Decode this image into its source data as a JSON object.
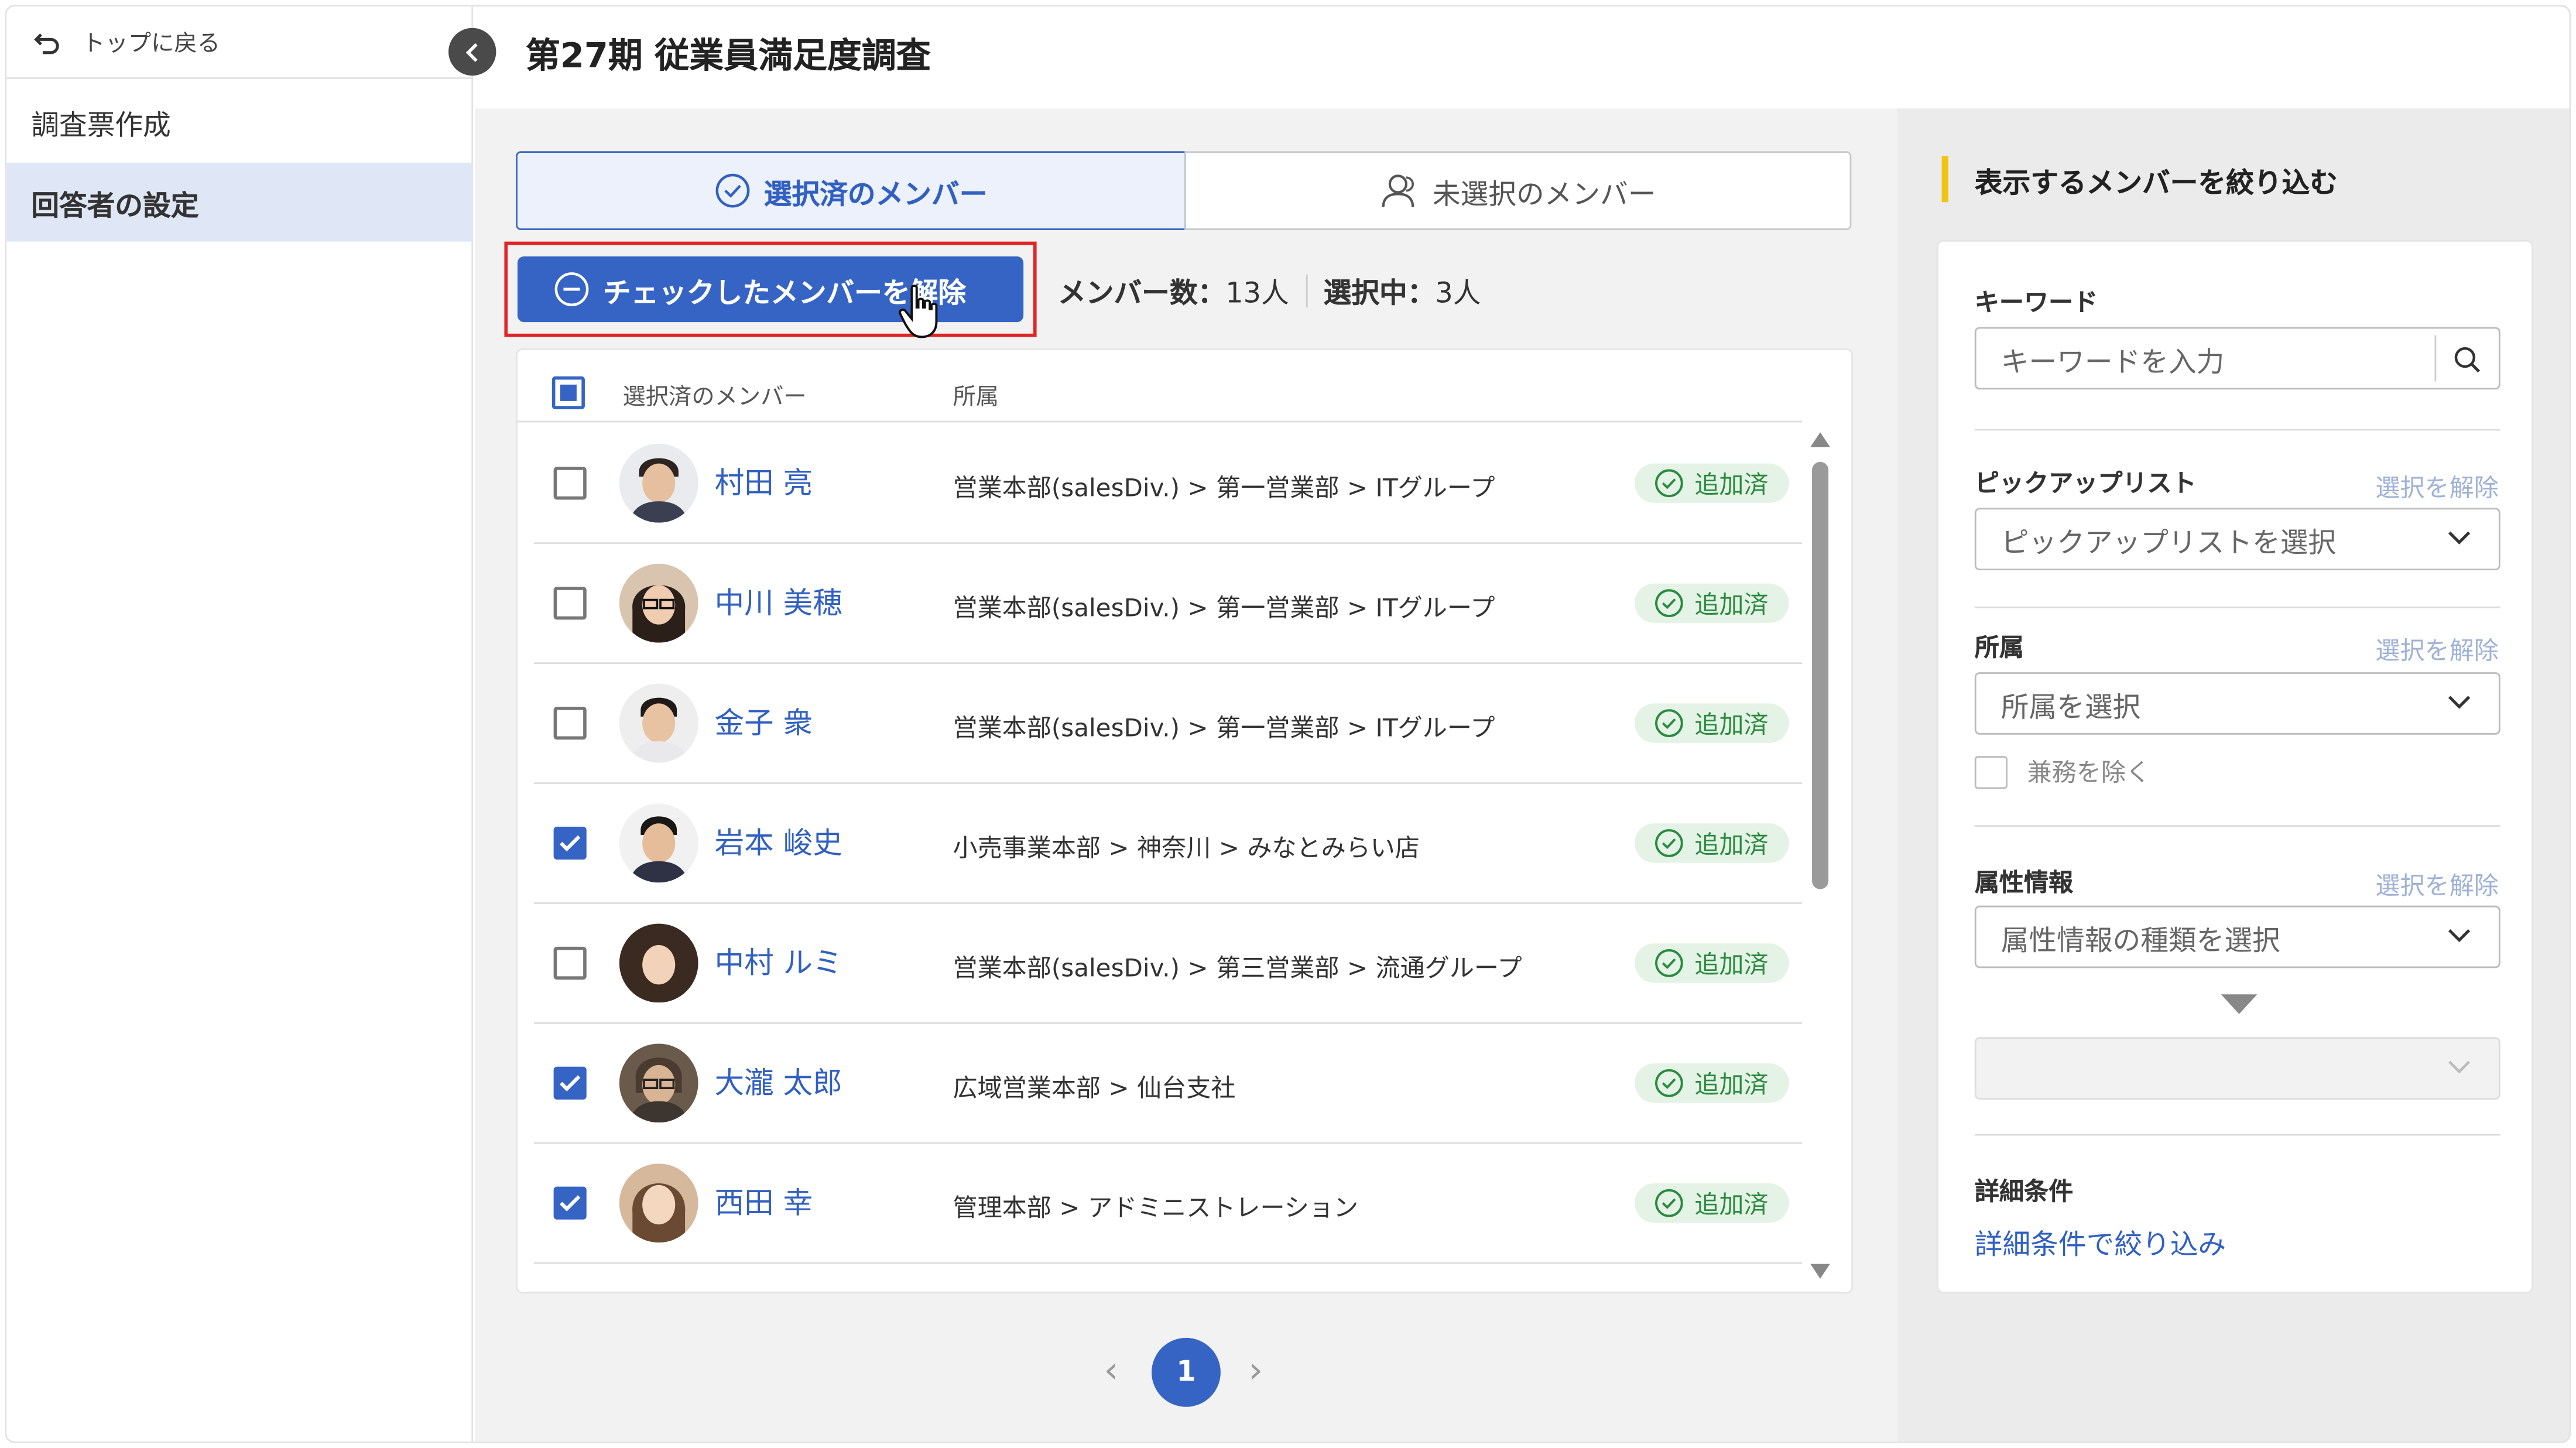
{
  "sidebar": {
    "back_label": "トップに戻る",
    "items": [
      {
        "label": "調査票作成"
      },
      {
        "label": "回答者の設定"
      }
    ]
  },
  "header": {
    "title": "第27期 従業員満足度調査"
  },
  "tabs": [
    {
      "label": "選択済のメンバー"
    },
    {
      "label": "未選択のメンバー"
    }
  ],
  "actions": {
    "uncheck_label": "チェックしたメンバーを解除",
    "member_count_label": "メンバー数：",
    "member_count_value": "13人",
    "selected_label": "選択中：",
    "selected_value": "3人"
  },
  "table": {
    "columns": [
      "選択済のメンバー",
      "所属"
    ],
    "rows": [
      {
        "name": "村田 亮",
        "dept": "営業本部(salesDiv.) > 第一営業部 > ITグループ",
        "status": "追加済",
        "checked": false
      },
      {
        "name": "中川 美穂",
        "dept": "営業本部(salesDiv.) > 第一営業部 > ITグループ",
        "status": "追加済",
        "checked": false
      },
      {
        "name": "金子 衆",
        "dept": "営業本部(salesDiv.) > 第一営業部 > ITグループ",
        "status": "追加済",
        "checked": false
      },
      {
        "name": "岩本 峻史",
        "dept": "小売事業本部 > 神奈川 > みなとみらい店",
        "status": "追加済",
        "checked": true
      },
      {
        "name": "中村 ルミ",
        "dept": "営業本部(salesDiv.) > 第三営業部 > 流通グループ",
        "status": "追加済",
        "checked": false
      },
      {
        "name": "大瀧 太郎",
        "dept": "広域営業本部 > 仙台支社",
        "status": "追加済",
        "checked": true
      },
      {
        "name": "西田 幸",
        "dept": "管理本部 > アドミニストレーション",
        "status": "追加済",
        "checked": true
      }
    ]
  },
  "pagination": {
    "current": "1"
  },
  "filter": {
    "title": "表示するメンバーを絞り込む",
    "keyword": {
      "label": "キーワード",
      "placeholder": "キーワードを入力"
    },
    "pickup": {
      "label": "ピックアップリスト",
      "clear": "選択を解除",
      "placeholder": "ピックアップリストを選択"
    },
    "dept": {
      "label": "所属",
      "clear": "選択を解除",
      "placeholder": "所属を選択",
      "exclude_label": "兼務を除く"
    },
    "attribute": {
      "label": "属性情報",
      "clear": "選択を解除",
      "placeholder": "属性情報の種類を選択"
    },
    "detail": {
      "label": "詳細条件",
      "link": "詳細条件で絞り込み"
    }
  },
  "colors": {
    "accent": "#3664c4",
    "highlight_border": "#e02424",
    "badge_bg": "#e4f3e6",
    "badge_text": "#2a8a3e",
    "title_bar": "#f1c40f"
  }
}
